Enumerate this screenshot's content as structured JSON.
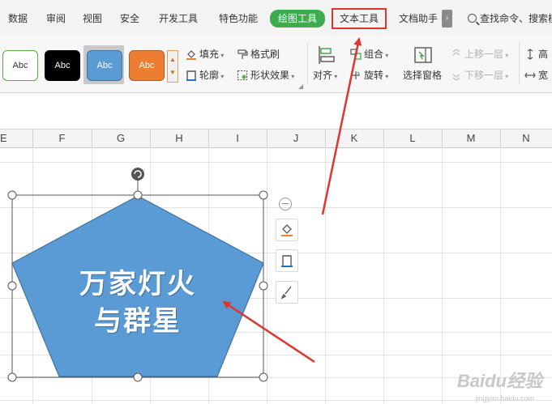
{
  "menu": {
    "tabs": [
      {
        "label": "数据"
      },
      {
        "label": "审阅"
      },
      {
        "label": "视图"
      },
      {
        "label": "安全"
      },
      {
        "label": "开发工具"
      },
      {
        "label": "特色功能"
      },
      {
        "label": "绘图工具",
        "active": true
      },
      {
        "label": "文本工具",
        "highlighted": true
      },
      {
        "label": "文档助手"
      }
    ],
    "more": "›",
    "search_label": "查找命令、搜索模"
  },
  "ribbon": {
    "style_label": "Abc",
    "styles": [
      {
        "label": "Abc",
        "fill": "#ffffff",
        "border": "#5aa846",
        "text": "#333333"
      },
      {
        "label": "Abc",
        "fill": "#000000",
        "border": "#000000",
        "text": "#ffffff"
      },
      {
        "label": "Abc",
        "fill": "#5b9bd5",
        "border": "#41719c",
        "text": "#ffffff"
      },
      {
        "label": "Abc",
        "fill": "#ed7d31",
        "border": "#ae5a21",
        "text": "#ffffff"
      }
    ],
    "fill": "填充",
    "format_painter": "格式刷",
    "outline": "轮廓",
    "shape_effect": "形状效果",
    "align": "对齐",
    "group": "组合",
    "rotate": "旋转",
    "selection_pane": "选择窗格",
    "bring_forward": "上移一层",
    "send_backward": "下移一层",
    "height": "高",
    "width": "宽"
  },
  "sheet": {
    "columns": [
      "E",
      "F",
      "G",
      "H",
      "I",
      "J",
      "K",
      "L",
      "M",
      "N"
    ]
  },
  "shape": {
    "line1": "万家灯火",
    "line2": "与群星",
    "fill_color": "#5b9bd5",
    "outline_color": "#41719c"
  },
  "watermark": {
    "logo": "Baidu经验",
    "url": "jingyan.baidu.com"
  },
  "colors": {
    "annotation_red": "#e0342f",
    "active_tab_green": "#3dab4e"
  }
}
